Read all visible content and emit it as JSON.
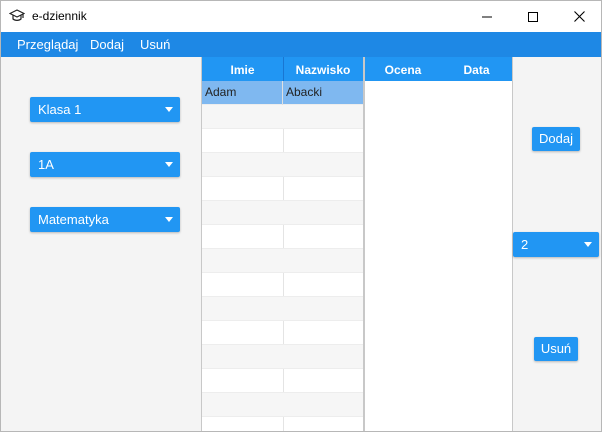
{
  "window": {
    "title": "e-dziennik",
    "icon": "graduation-cap-icon"
  },
  "menu": {
    "items": [
      "Przeglądaj",
      "Dodaj",
      "Usuń"
    ]
  },
  "filters": {
    "klasa": "Klasa 1",
    "oddzial": "1A",
    "przedmiot": "Matematyka"
  },
  "students_table": {
    "columns": [
      "Imie",
      "Nazwisko"
    ],
    "rows": [
      {
        "imie": "Adam",
        "nazwisko": "Abacki",
        "selected": true
      }
    ]
  },
  "grades_table": {
    "columns": [
      "Ocena",
      "Data"
    ],
    "rows": []
  },
  "grade_select": {
    "value": "2"
  },
  "buttons": {
    "add": "Dodaj",
    "delete": "Usuń"
  },
  "colors": {
    "accent": "#2196f3",
    "menubar": "#1e88e5",
    "selected_row": "#7fb8f0"
  }
}
